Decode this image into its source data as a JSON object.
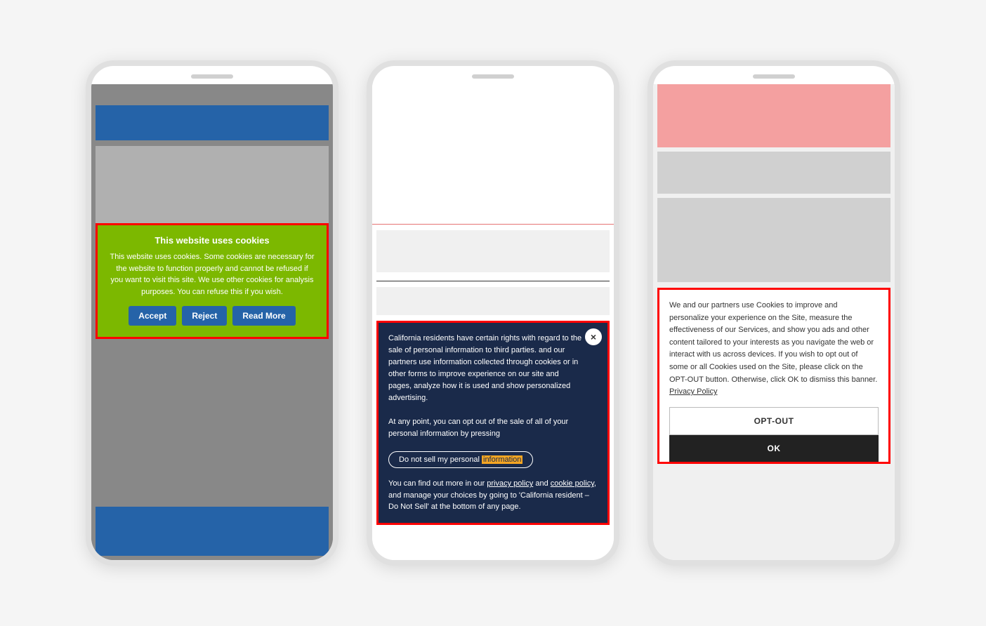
{
  "phone1": {
    "cookie_banner": {
      "title": "This website uses cookies",
      "body": "This website uses cookies. Some cookies are necessary for the website to function properly and cannot be refused if you want to visit this site. We use other cookies for analysis purposes. You can refuse this if you wish.",
      "accept_btn": "Accept",
      "reject_btn": "Reject",
      "read_more_btn": "Read More"
    }
  },
  "phone2": {
    "cookie_banner": {
      "close_icon": "×",
      "body_part1": "California residents have certain rights with regard to the sale of personal information to third parties.",
      "body_part2": "and our partners use information collected through cookies or in other forms to improve experience on our site and pages, analyze how it is used and show personalized advertising.",
      "body_part3": "At any point, you can opt out of the sale of all of your personal information by pressing",
      "opt_out_btn": "Do not sell my personal information",
      "highlight_word": "information",
      "footer_text_start": "You can find out more in our ",
      "privacy_link": "privacy policy",
      "footer_text_mid": " and ",
      "cookie_link": "cookie policy",
      "footer_text_end": ", and manage your choices by going to 'California resident – Do Not Sell' at the bottom of any page."
    }
  },
  "phone3": {
    "cookie_banner": {
      "body": "We and our partners use Cookies to improve and personalize your experience on the Site, measure the effectiveness of our Services, and show you ads and other content tailored to your interests as you navigate the web or interact with us across devices. If you wish to opt out of some or all Cookies used on the Site, please click on the OPT-OUT button. Otherwise, click OK to dismiss this banner.",
      "privacy_link": "Privacy Policy",
      "opt_out_btn": "OPT-OUT",
      "ok_btn": "OK"
    }
  }
}
